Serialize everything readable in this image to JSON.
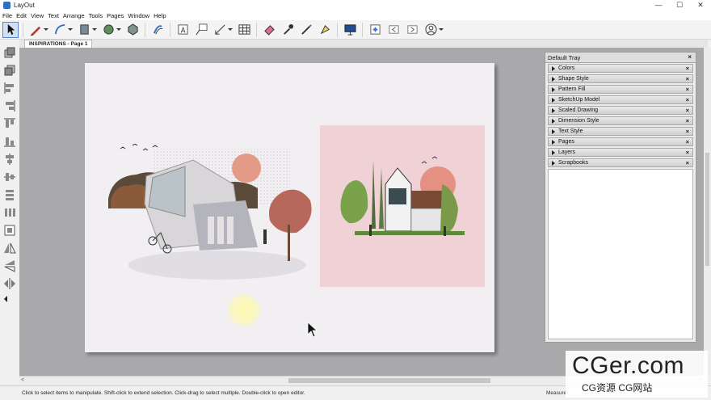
{
  "window": {
    "title": "LayOut",
    "minimize": "—",
    "maximize": "☐",
    "close": "✕"
  },
  "menu": [
    "File",
    "Edit",
    "View",
    "Text",
    "Arrange",
    "Tools",
    "Pages",
    "Window",
    "Help"
  ],
  "tabs": [
    {
      "label": "INSPIRATIONS - Page 1"
    }
  ],
  "tray": {
    "title": "Default Tray",
    "close": "×",
    "panels": [
      "Colors",
      "Shape Style",
      "Pattern Fill",
      "SketchUp Model",
      "Scaled Drawing",
      "Dimension Style",
      "Text Style",
      "Pages",
      "Layers",
      "Scrapbooks"
    ]
  },
  "scroll": {
    "left_arrow": "<",
    "right_arrow": ">"
  },
  "status": {
    "message": "Click to select items to manipulate. Shift-click to extend selection. Click-drag to select multiple. Double-click to open editor.",
    "measurements_label": "Measure"
  },
  "watermark": {
    "line1": "CGer.com",
    "line2": "CG资源 CG网站"
  },
  "colors": {
    "accent": "#2f6fc5",
    "canvas": "#a9a8ab",
    "paper": "#f1eff2",
    "pink_panel": "#efd1d6"
  },
  "icons": {
    "toolbar": [
      "select-arrow-icon",
      "pencil-icon",
      "arc-icon",
      "rectangle-icon",
      "circle-icon",
      "polygon-icon",
      "offset-icon",
      "text-icon",
      "label-icon",
      "dimension-icon",
      "table-icon",
      "eraser-icon",
      "style-dropper-icon",
      "split-icon",
      "join-icon",
      "presentation-icon",
      "add-page-icon",
      "previous-page-icon",
      "next-page-icon",
      "account-icon"
    ]
  }
}
